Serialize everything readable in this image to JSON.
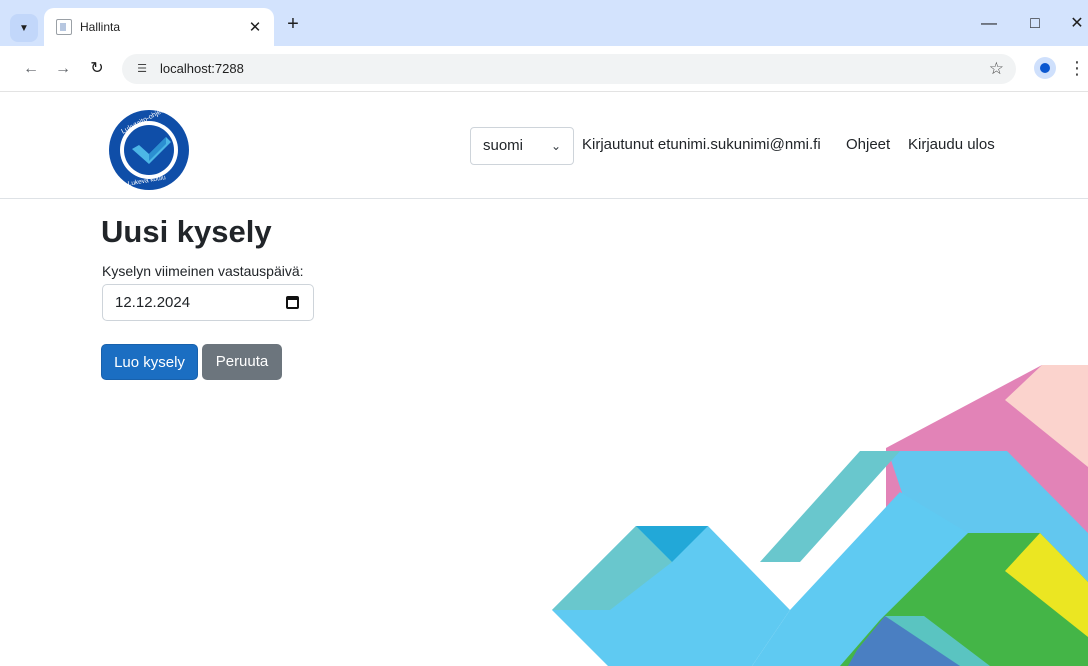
{
  "browser": {
    "tab_title": "Hallinta",
    "url": "localhost:7288"
  },
  "header": {
    "logo_text_top": "Lukutaito-ohjelma",
    "logo_text_bottom": "Lukeva koulu",
    "language": {
      "selected": "suomi",
      "options": [
        "suomi"
      ]
    },
    "logged_in": "Kirjautunut etunimi.sukunimi@nmi.fi",
    "help_link": "Ohjeet",
    "logout_link": "Kirjaudu ulos"
  },
  "main": {
    "title": "Uusi kysely",
    "deadline_label": "Kyselyn viimeinen vastauspäivä:",
    "deadline_value": "12.12.2024",
    "create_button": "Luo kysely",
    "cancel_button": "Peruuta"
  },
  "colors": {
    "primary": "#1b6ec2",
    "secondary": "#6c757d",
    "logo_blue": "#0f4ea8",
    "logo_light": "#4cb6e6"
  },
  "icons": {
    "tab_search": "chevron-down-icon",
    "tab_close": "close-icon",
    "new_tab": "plus-icon",
    "back": "arrow-left-icon",
    "forward": "arrow-right-icon",
    "reload": "reload-icon",
    "site_info": "tune-icon",
    "bookmark": "star-icon",
    "profile": "person-icon",
    "menu": "more-vertical-icon",
    "calendar": "calendar-icon",
    "select": "chevron-down-icon"
  }
}
